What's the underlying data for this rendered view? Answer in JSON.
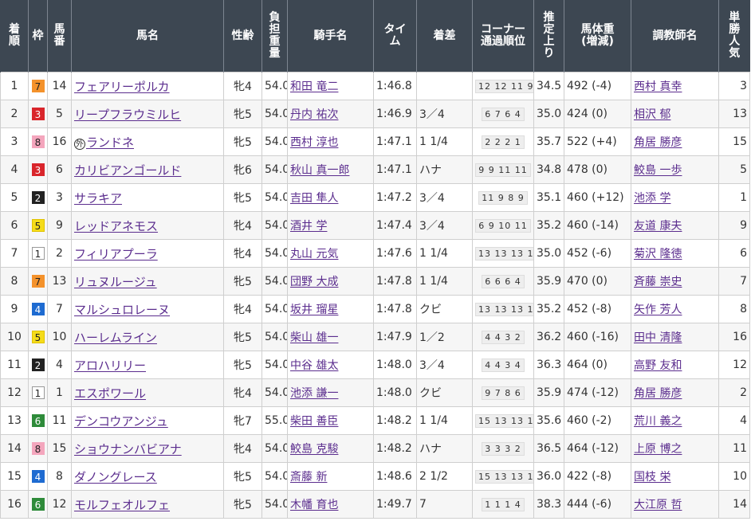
{
  "headers": {
    "rank": "着順",
    "waku": "枠",
    "umaban": "馬番",
    "horse": "馬名",
    "sex_age": "性齢",
    "weight_carried": "負担重量",
    "jockey": "騎手名",
    "time": "タイム",
    "margin": "着差",
    "corner": "コーナー通過順位",
    "last3f": "推定上り",
    "body_weight": "馬体重(増減)",
    "trainer": "調教師名",
    "popularity": "単勝人気"
  },
  "waku_colors": {
    "1": {
      "bg": "#ffffff",
      "fg": "#222222",
      "border": "#999999"
    },
    "2": {
      "bg": "#222222",
      "fg": "#ffffff",
      "border": "#222222"
    },
    "3": {
      "bg": "#d9252b",
      "fg": "#ffffff",
      "border": "#d9252b"
    },
    "4": {
      "bg": "#1e6bd1",
      "fg": "#ffffff",
      "border": "#1e6bd1"
    },
    "5": {
      "bg": "#f5dc1a",
      "fg": "#222222",
      "border": "#e0c200"
    },
    "6": {
      "bg": "#2e8b3a",
      "fg": "#ffffff",
      "border": "#2e8b3a"
    },
    "7": {
      "bg": "#f4922b",
      "fg": "#222222",
      "border": "#f4922b"
    },
    "8": {
      "bg": "#f4a6bd",
      "fg": "#222222",
      "border": "#f4a6bd"
    }
  },
  "rows": [
    {
      "rank": "1",
      "waku": "7",
      "umaban": "14",
      "mark": "",
      "horse": "フェアリーポルカ",
      "sex_age": "牝4",
      "weight": "54.0",
      "jockey": "和田 竜二",
      "time": "1:46.8",
      "margin": "",
      "corner": "12 12 11 9",
      "last3f": "34.5",
      "body_weight": "492 (-4)",
      "trainer": "西村 真幸",
      "popularity": "3"
    },
    {
      "rank": "2",
      "waku": "3",
      "umaban": "5",
      "mark": "",
      "horse": "リープフラウミルヒ",
      "sex_age": "牝5",
      "weight": "54.0",
      "jockey": "丹内 祐次",
      "time": "1:46.9",
      "margin": "3／4",
      "corner": "6 7 6 4",
      "last3f": "35.0",
      "body_weight": "424 (0)",
      "trainer": "相沢 郁",
      "popularity": "13"
    },
    {
      "rank": "3",
      "waku": "8",
      "umaban": "16",
      "mark": "外",
      "horse": "ランドネ",
      "sex_age": "牝5",
      "weight": "54.0",
      "jockey": "西村 淳也",
      "time": "1:47.1",
      "margin": "1 1/4",
      "corner": "2 2 2 1",
      "last3f": "35.7",
      "body_weight": "522 (+4)",
      "trainer": "角居 勝彦",
      "popularity": "15"
    },
    {
      "rank": "4",
      "waku": "3",
      "umaban": "6",
      "mark": "",
      "horse": "カリビアンゴールド",
      "sex_age": "牝6",
      "weight": "54.0",
      "jockey": "秋山 真一郎",
      "time": "1:47.1",
      "margin": "ハナ",
      "corner": "9 9 11 11",
      "last3f": "34.8",
      "body_weight": "478 (0)",
      "trainer": "鮫島 一歩",
      "popularity": "5"
    },
    {
      "rank": "5",
      "waku": "2",
      "umaban": "3",
      "mark": "",
      "horse": "サラキア",
      "sex_age": "牝5",
      "weight": "54.0",
      "jockey": "吉田 隼人",
      "time": "1:47.2",
      "margin": "3／4",
      "corner": "11 9 8 9",
      "last3f": "35.1",
      "body_weight": "460 (+12)",
      "trainer": "池添 学",
      "popularity": "1"
    },
    {
      "rank": "6",
      "waku": "5",
      "umaban": "9",
      "mark": "",
      "horse": "レッドアネモス",
      "sex_age": "牝4",
      "weight": "54.0",
      "jockey": "酒井 学",
      "time": "1:47.4",
      "margin": "3／4",
      "corner": "6 9 10 11",
      "last3f": "35.2",
      "body_weight": "460 (-14)",
      "trainer": "友道 康夫",
      "popularity": "9"
    },
    {
      "rank": "7",
      "waku": "1",
      "umaban": "2",
      "mark": "",
      "horse": "フィリアプーラ",
      "sex_age": "牝4",
      "weight": "54.0",
      "jockey": "丸山 元気",
      "time": "1:47.6",
      "margin": "1 1/4",
      "corner": "13 13 13 13",
      "last3f": "35.0",
      "body_weight": "452 (-6)",
      "trainer": "菊沢 隆徳",
      "popularity": "6"
    },
    {
      "rank": "8",
      "waku": "7",
      "umaban": "13",
      "mark": "",
      "horse": "リュヌルージュ",
      "sex_age": "牝5",
      "weight": "54.0",
      "jockey": "団野 大成",
      "time": "1:47.8",
      "margin": "1 1/4",
      "corner": "6 6 6 4",
      "last3f": "35.9",
      "body_weight": "470 (0)",
      "trainer": "斉藤 崇史",
      "popularity": "7"
    },
    {
      "rank": "9",
      "waku": "4",
      "umaban": "7",
      "mark": "",
      "horse": "マルシュロレーヌ",
      "sex_age": "牝4",
      "weight": "54.0",
      "jockey": "坂井 瑠星",
      "time": "1:47.8",
      "margin": "クビ",
      "corner": "13 13 13 14",
      "last3f": "35.2",
      "body_weight": "452 (-8)",
      "trainer": "矢作 芳人",
      "popularity": "8"
    },
    {
      "rank": "10",
      "waku": "5",
      "umaban": "10",
      "mark": "",
      "horse": "ハーレムライン",
      "sex_age": "牝5",
      "weight": "54.0",
      "jockey": "柴山 雄一",
      "time": "1:47.9",
      "margin": "1／2",
      "corner": "4 4 3 2",
      "last3f": "36.2",
      "body_weight": "460 (-16)",
      "trainer": "田中 清隆",
      "popularity": "16"
    },
    {
      "rank": "11",
      "waku": "2",
      "umaban": "4",
      "mark": "",
      "horse": "アロハリリー",
      "sex_age": "牝5",
      "weight": "54.0",
      "jockey": "中谷 雄太",
      "time": "1:48.0",
      "margin": "3／4",
      "corner": "4 4 3 4",
      "last3f": "36.3",
      "body_weight": "464 (0)",
      "trainer": "高野 友和",
      "popularity": "12"
    },
    {
      "rank": "12",
      "waku": "1",
      "umaban": "1",
      "mark": "",
      "horse": "エスポワール",
      "sex_age": "牝4",
      "weight": "54.0",
      "jockey": "池添 謙一",
      "time": "1:48.0",
      "margin": "クビ",
      "corner": "9 7 8 6",
      "last3f": "35.9",
      "body_weight": "474 (-12)",
      "trainer": "角居 勝彦",
      "popularity": "2"
    },
    {
      "rank": "13",
      "waku": "6",
      "umaban": "11",
      "mark": "",
      "horse": "デンコウアンジュ",
      "sex_age": "牝7",
      "weight": "55.0",
      "jockey": "柴田 善臣",
      "time": "1:48.2",
      "margin": "1 1/4",
      "corner": "15 13 13 14",
      "last3f": "35.6",
      "body_weight": "460 (-2)",
      "trainer": "荒川 義之",
      "popularity": "4"
    },
    {
      "rank": "14",
      "waku": "8",
      "umaban": "15",
      "mark": "",
      "horse": "ショウナンバビアナ",
      "sex_age": "牝4",
      "weight": "54.0",
      "jockey": "鮫島 克駿",
      "time": "1:48.2",
      "margin": "ハナ",
      "corner": "3 3 3 2",
      "last3f": "36.5",
      "body_weight": "464 (-12)",
      "trainer": "上原 博之",
      "popularity": "11"
    },
    {
      "rank": "15",
      "waku": "4",
      "umaban": "8",
      "mark": "",
      "horse": "ダノングレース",
      "sex_age": "牝5",
      "weight": "54.0",
      "jockey": "斎藤 新",
      "time": "1:48.6",
      "margin": "2 1/2",
      "corner": "15 13 13 14",
      "last3f": "36.0",
      "body_weight": "422 (-8)",
      "trainer": "国枝 栄",
      "popularity": "10"
    },
    {
      "rank": "16",
      "waku": "6",
      "umaban": "12",
      "mark": "",
      "horse": "モルフェオルフェ",
      "sex_age": "牝5",
      "weight": "54.0",
      "jockey": "木幡 育也",
      "time": "1:49.7",
      "margin": "7",
      "corner": "1 1 1 4",
      "last3f": "38.3",
      "body_weight": "444 (-6)",
      "trainer": "大江原 哲",
      "popularity": "14"
    }
  ]
}
